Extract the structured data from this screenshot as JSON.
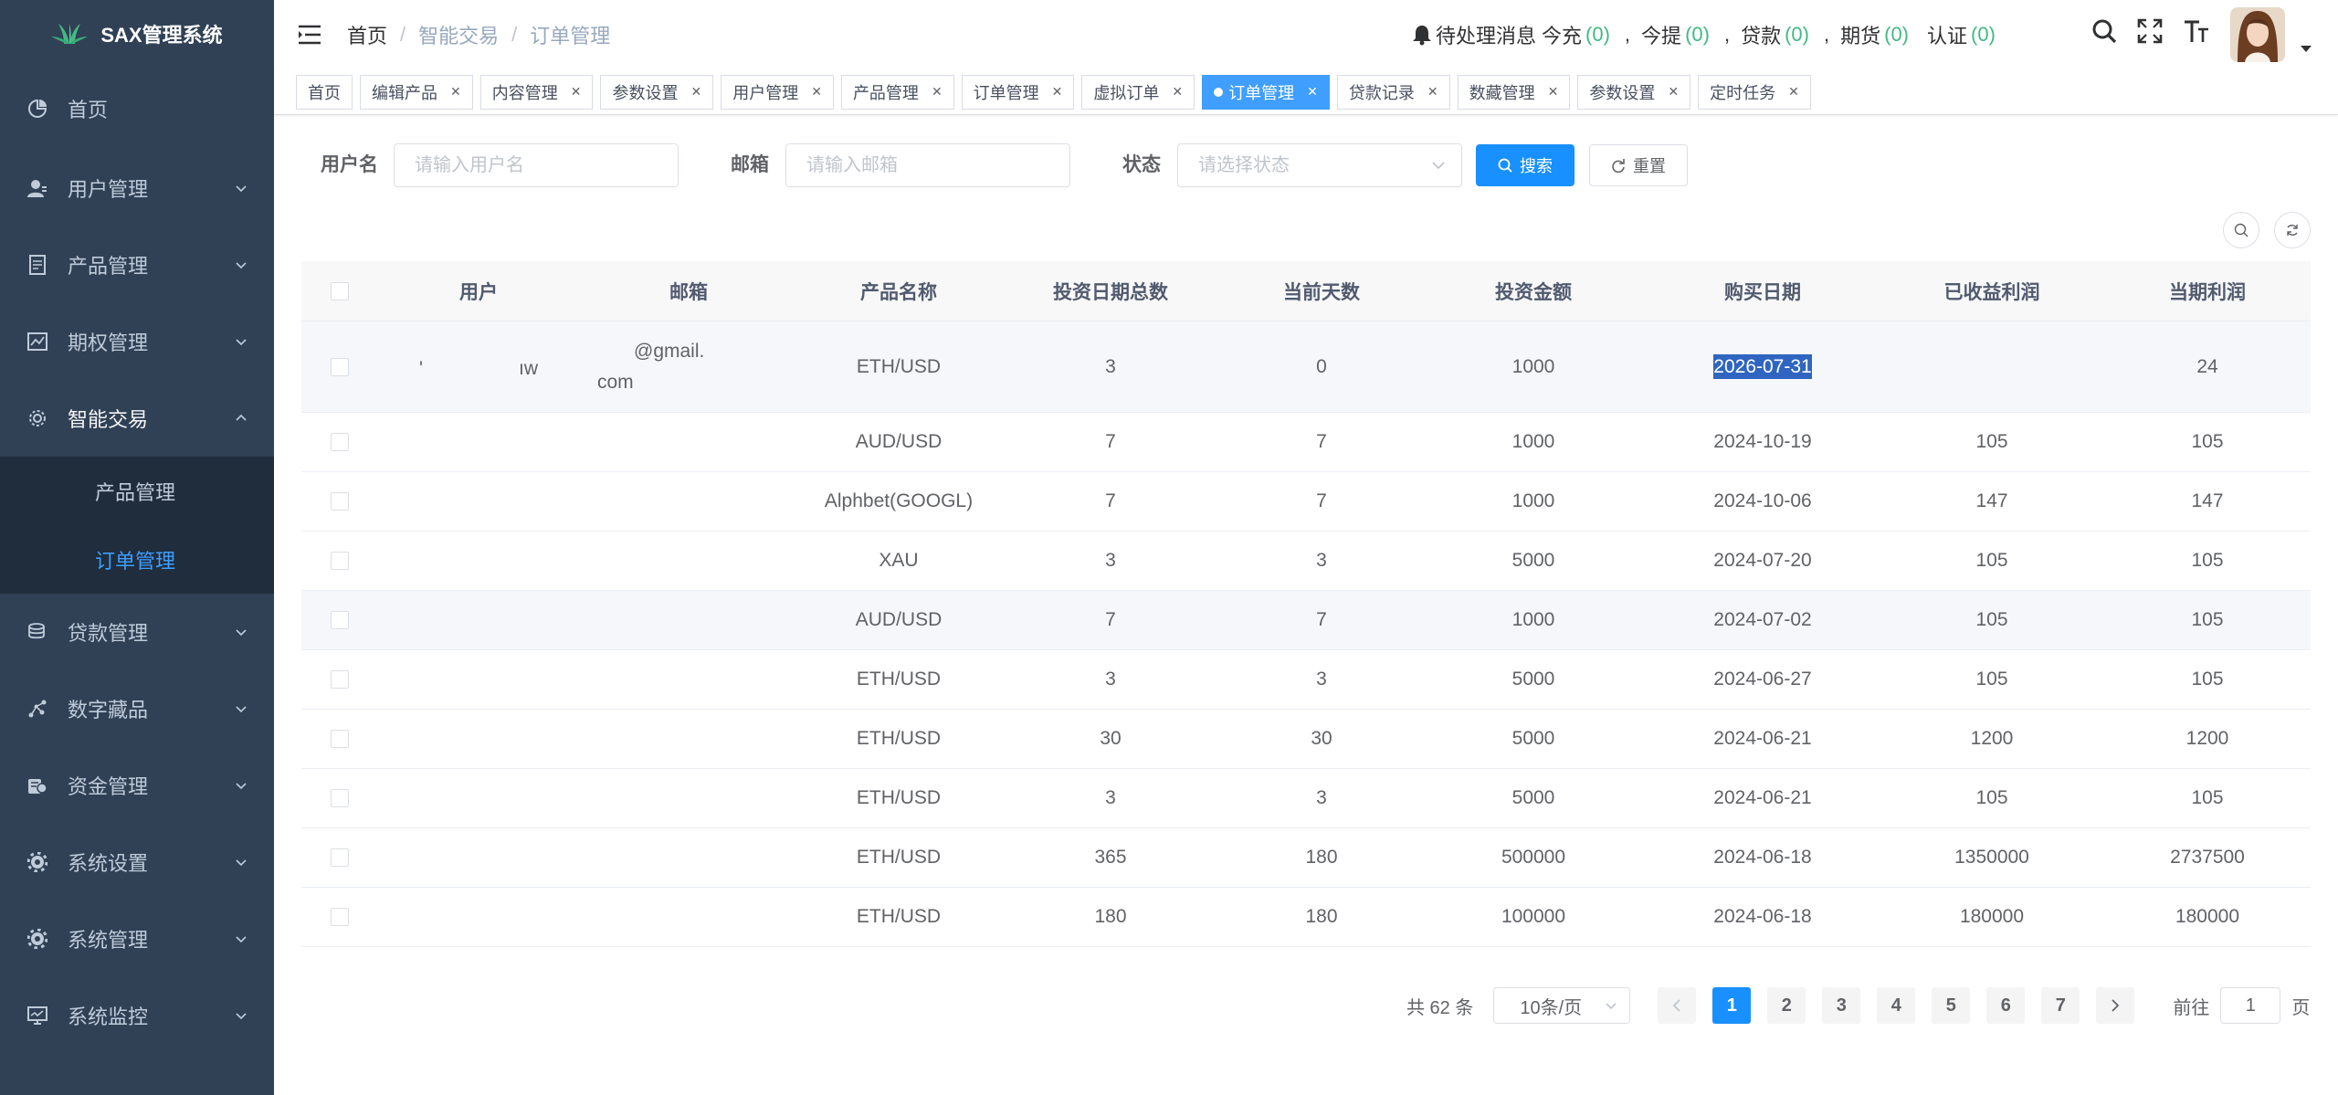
{
  "app": {
    "title": "SAX管理系统"
  },
  "sidebar": {
    "items": [
      {
        "label": "首页"
      },
      {
        "label": "用户管理"
      },
      {
        "label": "产品管理"
      },
      {
        "label": "期权管理"
      },
      {
        "label": "智能交易"
      },
      {
        "label": "贷款管理"
      },
      {
        "label": "数字藏品"
      },
      {
        "label": "资金管理"
      },
      {
        "label": "系统设置"
      },
      {
        "label": "系统管理"
      },
      {
        "label": "系统监控"
      }
    ],
    "submenu": [
      {
        "label": "产品管理"
      },
      {
        "label": "订单管理"
      }
    ]
  },
  "header": {
    "breadcrumb": [
      "首页",
      "智能交易",
      "订单管理"
    ],
    "notice": {
      "label": "待处理消息",
      "items": [
        {
          "label": "今充",
          "count": "(0)"
        },
        {
          "label": "今提",
          "count": "(0)"
        },
        {
          "label": "贷款",
          "count": "(0)"
        },
        {
          "label": "期货",
          "count": "(0)"
        },
        {
          "label": "认证",
          "count": "(0)"
        }
      ]
    }
  },
  "tags": [
    {
      "label": "首页"
    },
    {
      "label": "编辑产品"
    },
    {
      "label": "内容管理"
    },
    {
      "label": "参数设置"
    },
    {
      "label": "用户管理"
    },
    {
      "label": "产品管理"
    },
    {
      "label": "订单管理"
    },
    {
      "label": "虚拟订单"
    },
    {
      "label": "订单管理"
    },
    {
      "label": "贷款记录"
    },
    {
      "label": "数藏管理"
    },
    {
      "label": "参数设置"
    },
    {
      "label": "定时任务"
    }
  ],
  "filters": {
    "username_label": "用户名",
    "username_placeholder": "请输入用户名",
    "email_label": "邮箱",
    "email_placeholder": "请输入邮箱",
    "status_label": "状态",
    "status_placeholder": "请选择状态",
    "search_label": "搜索",
    "reset_label": "重置"
  },
  "table": {
    "columns": [
      "用户",
      "邮箱",
      "产品名称",
      "投资日期总数",
      "当前天数",
      "投资金额",
      "购买日期",
      "已收益利润",
      "当期利润"
    ],
    "rows": [
      {
        "user": "'　　　　　ıw",
        "email1": "@gmail.",
        "email2": "com",
        "product": "ETH/USD",
        "total_days": "3",
        "current_days": "0",
        "amount": "1000",
        "date": "2026-07-31",
        "earned": "",
        "current_profit": "24"
      },
      {
        "user": "",
        "email1": "",
        "email2": "",
        "product": "AUD/USD",
        "total_days": "7",
        "current_days": "7",
        "amount": "1000",
        "date": "2024-10-19",
        "earned": "105",
        "current_profit": "105"
      },
      {
        "user": "",
        "email1": "",
        "email2": "",
        "product": "Alphbet(GOOGL)",
        "total_days": "7",
        "current_days": "7",
        "amount": "1000",
        "date": "2024-10-06",
        "earned": "147",
        "current_profit": "147"
      },
      {
        "user": "",
        "email1": "",
        "email2": "",
        "product": "XAU",
        "total_days": "3",
        "current_days": "3",
        "amount": "5000",
        "date": "2024-07-20",
        "earned": "105",
        "current_profit": "105"
      },
      {
        "user": "",
        "email1": "",
        "email2": "",
        "product": "AUD/USD",
        "total_days": "7",
        "current_days": "7",
        "amount": "1000",
        "date": "2024-07-02",
        "earned": "105",
        "current_profit": "105"
      },
      {
        "user": "",
        "email1": "",
        "email2": "",
        "product": "ETH/USD",
        "total_days": "3",
        "current_days": "3",
        "amount": "5000",
        "date": "2024-06-27",
        "earned": "105",
        "current_profit": "105"
      },
      {
        "user": "",
        "email1": "",
        "email2": "",
        "product": "ETH/USD",
        "total_days": "30",
        "current_days": "30",
        "amount": "5000",
        "date": "2024-06-21",
        "earned": "1200",
        "current_profit": "1200"
      },
      {
        "user": "",
        "email1": "",
        "email2": "",
        "product": "ETH/USD",
        "total_days": "3",
        "current_days": "3",
        "amount": "5000",
        "date": "2024-06-21",
        "earned": "105",
        "current_profit": "105"
      },
      {
        "user": "",
        "email1": "",
        "email2": "",
        "product": "ETH/USD",
        "total_days": "365",
        "current_days": "180",
        "amount": "500000",
        "date": "2024-06-18",
        "earned": "1350000",
        "current_profit": "2737500"
      },
      {
        "user": "",
        "email1": "",
        "email2": "",
        "product": "ETH/USD",
        "total_days": "180",
        "current_days": "180",
        "amount": "100000",
        "date": "2024-06-18",
        "earned": "180000",
        "current_profit": "180000"
      }
    ]
  },
  "pagination": {
    "total": "共 62 条",
    "page_size": "10条/页",
    "pages": [
      "1",
      "2",
      "3",
      "4",
      "5",
      "6",
      "7"
    ],
    "current": "1",
    "goto_prefix": "前往",
    "goto_suffix": "页"
  },
  "colors": {
    "sidebar_bg": "#304156",
    "primary": "#1890ff",
    "notice_count": "#42b983",
    "active_text": "#409eff"
  }
}
